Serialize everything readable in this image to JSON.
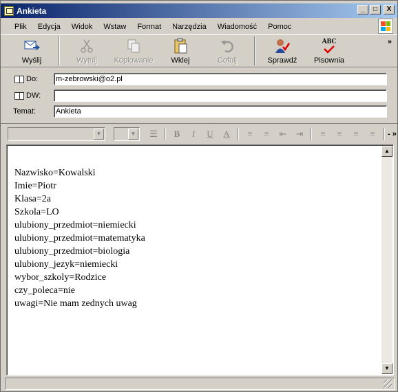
{
  "window": {
    "title": "Ankieta"
  },
  "titlebar_buttons": {
    "minimize": "_",
    "maximize": "□",
    "close": "X"
  },
  "menu": [
    "Plik",
    "Edycja",
    "Widok",
    "Wstaw",
    "Format",
    "Narzędzia",
    "Wiadomość",
    "Pomoc"
  ],
  "toolbar": {
    "send": "Wyślij",
    "cut": "Wytnij",
    "copy": "Kopiowanie",
    "paste": "Wklej",
    "undo": "Cofnij",
    "check": "Sprawdź",
    "spelling": "Pisownia",
    "spelling_icon_text": "ABC",
    "more": "»"
  },
  "fields": {
    "to_label": "Do:",
    "to_value": "m-zebrowski@o2.pl",
    "cc_label": "DW:",
    "cc_value": "",
    "subject_label": "Temat:",
    "subject_value": "Ankieta"
  },
  "format_bar": {
    "bold": "B",
    "italic": "I",
    "underline": "U",
    "font_color": "A",
    "more": "- »"
  },
  "message_body": [
    "Nazwisko=Kowalski",
    "Imie=Piotr",
    "Klasa=2a",
    "Szkola=LO",
    "ulubiony_przedmiot=niemiecki",
    "ulubiony_przedmiot=matematyka",
    "ulubiony_przedmiot=biologia",
    "ulubiony_jezyk=niemiecki",
    "wybor_szkoly=Rodzice",
    "czy_poleca=nie",
    "uwagi=Nie mam zednych uwag"
  ],
  "colors": {
    "titlebar_start": "#0a246a",
    "titlebar_end": "#a6caf0",
    "face": "#d4d0c8"
  }
}
